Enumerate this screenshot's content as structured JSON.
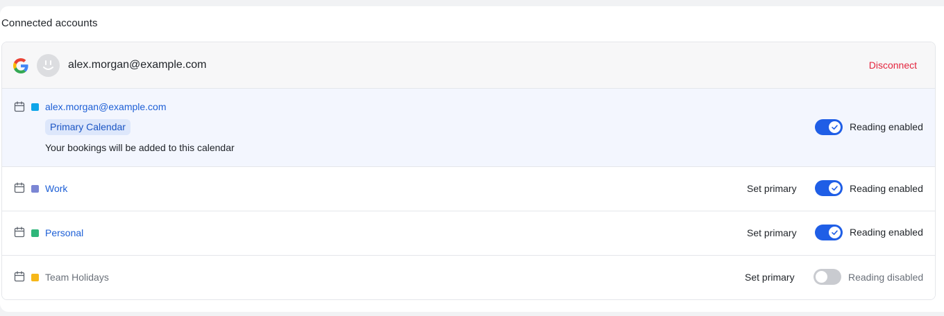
{
  "section": {
    "title": "Connected accounts"
  },
  "account": {
    "provider_icon": "google-icon",
    "email": "alex.morgan@example.com",
    "disconnect_label": "Disconnect"
  },
  "calendars": [
    {
      "name": "alex.morgan@example.com",
      "color": "#0ea5e9",
      "badge": "Primary Calendar",
      "note": "Your bookings will be added to this calendar",
      "reading_label": "Reading enabled",
      "reading_on": true
    },
    {
      "name": "Work",
      "color": "#7b86d4",
      "set_primary_label": "Set primary",
      "reading_label": "Reading enabled",
      "reading_on": true
    },
    {
      "name": "Personal",
      "color": "#2fb67a",
      "set_primary_label": "Set primary",
      "reading_label": "Reading enabled",
      "reading_on": true
    },
    {
      "name": "Team Holidays",
      "color": "#f6b719",
      "set_primary_label": "Set primary",
      "reading_label": "Reading disabled",
      "reading_on": false
    }
  ],
  "colors": {
    "accent": "#1f5ee6",
    "link": "#1d5fd6",
    "danger": "#e3243d"
  }
}
